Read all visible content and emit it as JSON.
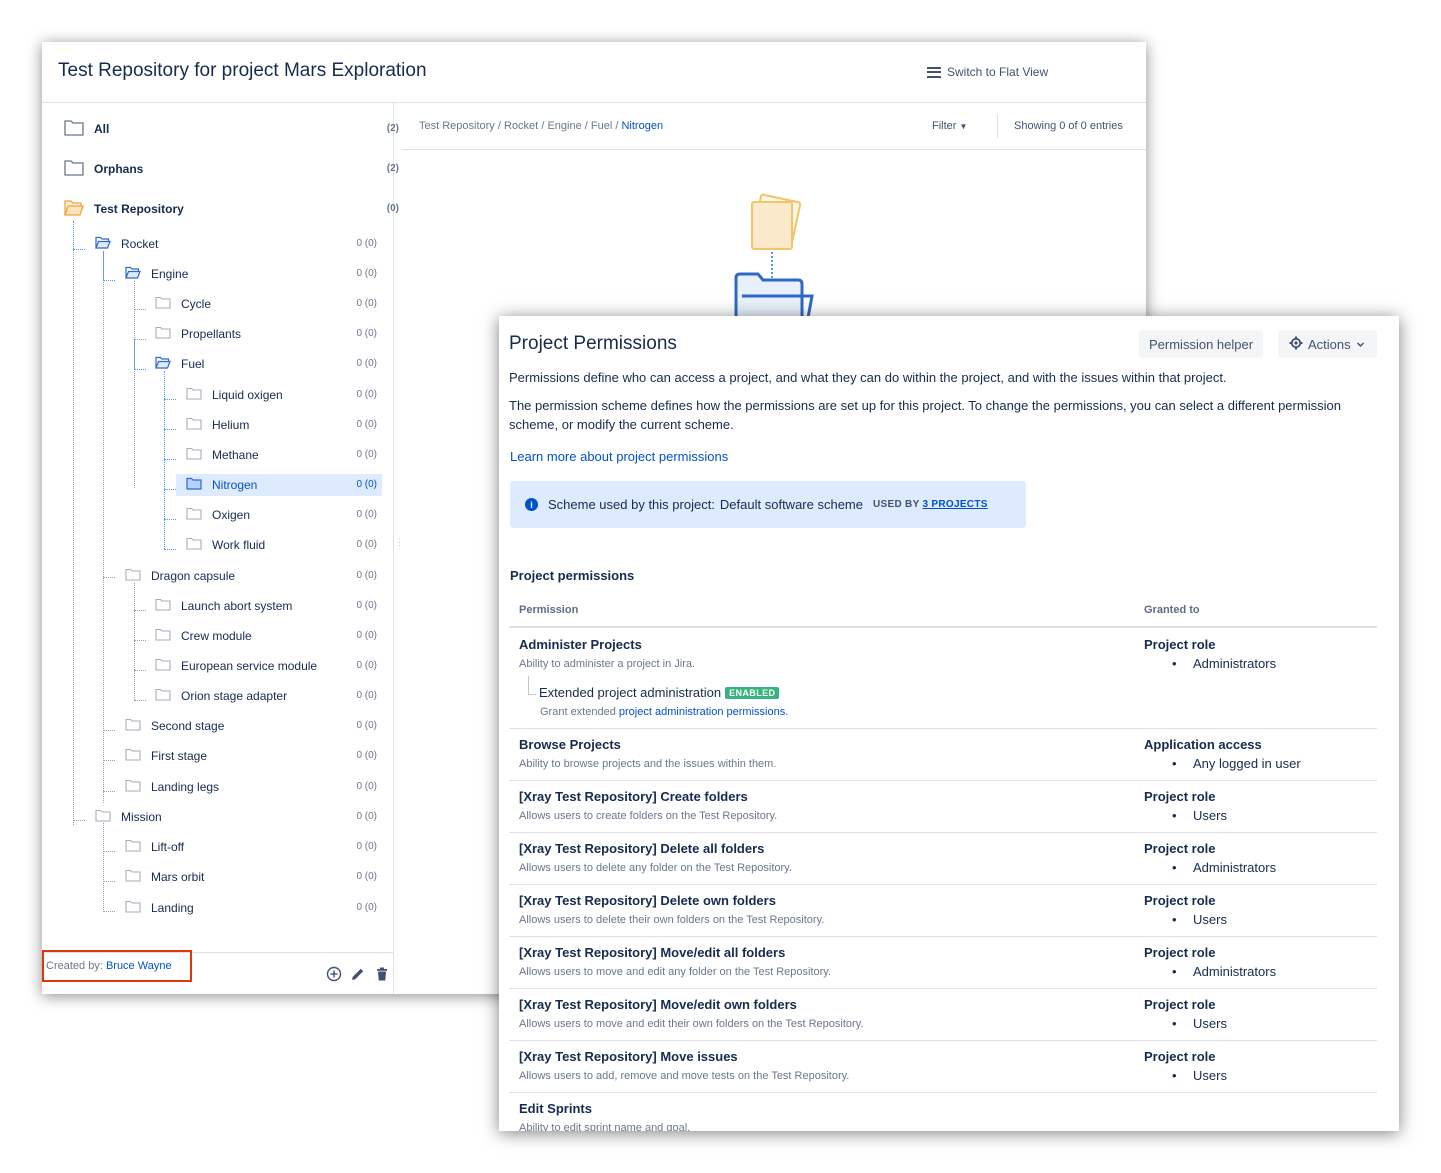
{
  "repo": {
    "title": "Test Repository for project Mars Exploration",
    "switch_label": "Switch to Flat View",
    "breadcrumb": [
      "Test Repository",
      "Rocket",
      "Engine",
      "Fuel"
    ],
    "breadcrumb_sep": "/",
    "breadcrumb_current": "Nitrogen",
    "filter_label": "Filter",
    "showing": "Showing 0 of 0 entries",
    "created_by_label": "Created by:",
    "created_by_user": "Bruce Wayne",
    "tree": [
      {
        "label": "All",
        "count": "(2)"
      },
      {
        "label": "Orphans",
        "count": "(2)"
      },
      {
        "label": "Test Repository",
        "count": "(0)"
      },
      {
        "label": "Rocket",
        "count": "0 (0)"
      },
      {
        "label": "Engine",
        "count": "0 (0)"
      },
      {
        "label": "Cycle",
        "count": "0 (0)"
      },
      {
        "label": "Propellants",
        "count": "0 (0)"
      },
      {
        "label": "Fuel",
        "count": "0 (0)"
      },
      {
        "label": "Liquid oxigen",
        "count": "0 (0)"
      },
      {
        "label": "Helium",
        "count": "0 (0)"
      },
      {
        "label": "Methane",
        "count": "0 (0)"
      },
      {
        "label": "Nitrogen",
        "count": "0 (0)"
      },
      {
        "label": "Oxigen",
        "count": "0 (0)"
      },
      {
        "label": "Work fluid",
        "count": "0 (0)"
      },
      {
        "label": "Dragon capsule",
        "count": "0 (0)"
      },
      {
        "label": "Launch abort system",
        "count": "0 (0)"
      },
      {
        "label": "Crew module",
        "count": "0 (0)"
      },
      {
        "label": "European service module",
        "count": "0 (0)"
      },
      {
        "label": "Orion stage adapter",
        "count": "0 (0)"
      },
      {
        "label": "Second stage",
        "count": "0 (0)"
      },
      {
        "label": "First stage",
        "count": "0 (0)"
      },
      {
        "label": "Landing legs",
        "count": "0 (0)"
      },
      {
        "label": "Mission",
        "count": "0 (0)"
      },
      {
        "label": "Lift-off",
        "count": "0 (0)"
      },
      {
        "label": "Mars orbit",
        "count": "0 (0)"
      },
      {
        "label": "Landing",
        "count": "0 (0)"
      }
    ]
  },
  "permissions": {
    "title": "Project Permissions",
    "helper_button": "Permission helper",
    "actions_button": "Actions",
    "desc1": "Permissions define who can access a project, and what they can do within the project, and with the issues within that project.",
    "desc2": "The permission scheme defines how the permissions are set up for this project. To change the permissions, you can select a different permission scheme, or modify the current scheme.",
    "learn_more": "Learn more about project permissions",
    "scheme_label": "Scheme used by this project:",
    "scheme_name": "Default software scheme",
    "used_by_label": "USED BY",
    "used_by_link": "3 PROJECTS",
    "section_title": "Project permissions",
    "col_permission": "Permission",
    "col_granted": "Granted to",
    "extended": {
      "name": "Extended project administration",
      "badge": "ENABLED",
      "desc_prefix": "Grant extended",
      "desc_link": "project administration permissions."
    },
    "rows": [
      {
        "name": "Administer Projects",
        "desc": "Ability to administer a project in Jira.",
        "grant_type": "Project role",
        "grant_value": "Administrators"
      },
      {
        "name": "Browse Projects",
        "desc": "Ability to browse projects and the issues within them.",
        "grant_type": "Application access",
        "grant_value": "Any logged in user"
      },
      {
        "name": "[Xray Test Repository] Create folders",
        "desc": "Allows users to create folders on the Test Repository.",
        "grant_type": "Project role",
        "grant_value": "Users"
      },
      {
        "name": "[Xray Test Repository] Delete all folders",
        "desc": "Allows users to delete any folder on the Test Repository.",
        "grant_type": "Project role",
        "grant_value": "Administrators"
      },
      {
        "name": "[Xray Test Repository] Delete own folders",
        "desc": "Allows users to delete their own folders on the Test Repository.",
        "grant_type": "Project role",
        "grant_value": "Users"
      },
      {
        "name": "[Xray Test Repository] Move/edit all folders",
        "desc": "Allows users to move and edit any folder on the Test Repository.",
        "grant_type": "Project role",
        "grant_value": "Administrators"
      },
      {
        "name": "[Xray Test Repository] Move/edit own folders",
        "desc": "Allows users to move and edit their own folders on the Test Repository.",
        "grant_type": "Project role",
        "grant_value": "Users"
      },
      {
        "name": "[Xray Test Repository] Move issues",
        "desc": "Allows users to add, remove and move tests on the Test Repository.",
        "grant_type": "Project role",
        "grant_value": "Users"
      },
      {
        "name": "Edit Sprints",
        "desc": "Ability to edit sprint name and goal."
      }
    ]
  }
}
